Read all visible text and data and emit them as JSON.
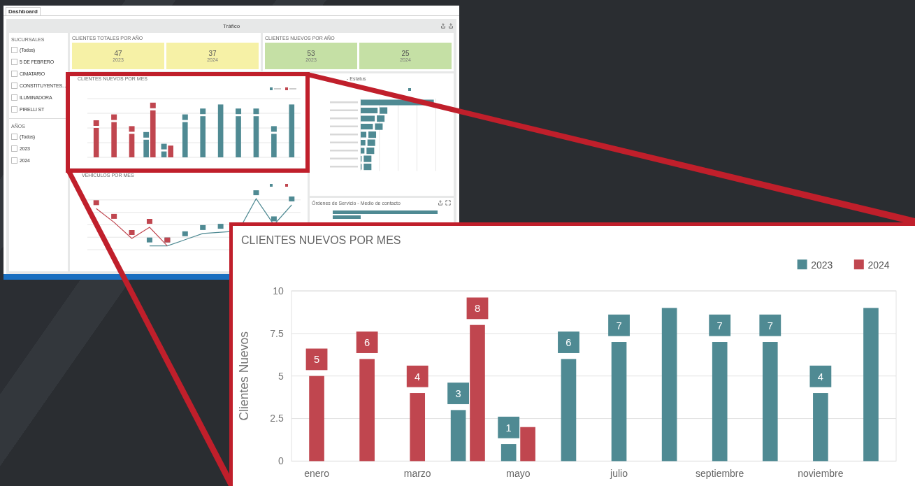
{
  "dashboard": {
    "tab": "Dashboard",
    "title": "Tráfico",
    "filters": [
      {
        "title": "SUCURSALES",
        "items": [
          {
            "label": "(Todos)",
            "checked": false
          },
          {
            "label": "5 DE FEBRERO",
            "checked": false
          },
          {
            "label": "CIMATARIO",
            "checked": false
          },
          {
            "label": "CONSTITUYENTES...",
            "checked": false
          },
          {
            "label": "ILUMINADORA",
            "checked": false
          },
          {
            "label": "PIRELLI ST",
            "checked": false
          }
        ]
      },
      {
        "title": "AÑOS",
        "items": [
          {
            "label": "(Todos)",
            "checked": false
          },
          {
            "label": "2023",
            "checked": false
          },
          {
            "label": "2024",
            "checked": false
          }
        ]
      }
    ],
    "kpis": [
      {
        "title": "CLIENTES TOTALES POR AÑO",
        "color": "#f6f1a6",
        "cards": [
          {
            "value": "47",
            "year": "2023"
          },
          {
            "value": "37",
            "year": "2024"
          }
        ]
      },
      {
        "title": "CLIENTES NUEVOS POR AÑO",
        "color": "#c5e0a5",
        "cards": [
          {
            "value": "53",
            "year": "2023"
          },
          {
            "value": "25",
            "year": "2024"
          }
        ]
      }
    ],
    "monthly_chart": {
      "title": "CLIENTES NUEVOS POR MES"
    },
    "status_chart": {
      "title": "- Estatus"
    },
    "vehicles_chart": {
      "title": "VEHÍCULOS POR MES"
    },
    "contact_panel": {
      "title": "Órdenes de Servicio - Medio de contacto"
    }
  },
  "zoom": {
    "title": "CLIENTES NUEVOS POR MES",
    "chart_data": {
      "type": "bar",
      "ylabel": "Clientes Nuevos",
      "ylim": [
        0,
        10
      ],
      "yticks": [
        0,
        2.5,
        5,
        7.5,
        10
      ],
      "grid": true,
      "legend": "top-right",
      "categories": [
        "enero",
        null,
        "marzo",
        null,
        "mayo",
        null,
        "julio",
        null,
        "septiembre",
        null,
        "noviembre",
        null
      ],
      "series": [
        {
          "name": "2023",
          "color": "#4f8a93",
          "values": [
            null,
            null,
            null,
            3,
            1,
            6,
            7,
            9,
            7,
            7,
            4,
            9
          ],
          "value_labels": [
            null,
            null,
            null,
            "3",
            "1",
            "6",
            "7",
            null,
            "7",
            "7",
            "4",
            null
          ]
        },
        {
          "name": "2024",
          "color": "#c0464f",
          "values": [
            5,
            6,
            4,
            8,
            2,
            null,
            null,
            null,
            null,
            null,
            null,
            null
          ],
          "value_labels": [
            "5",
            "6",
            "4",
            "8",
            null,
            null,
            null,
            null,
            null,
            null,
            null,
            null
          ]
        }
      ]
    }
  }
}
